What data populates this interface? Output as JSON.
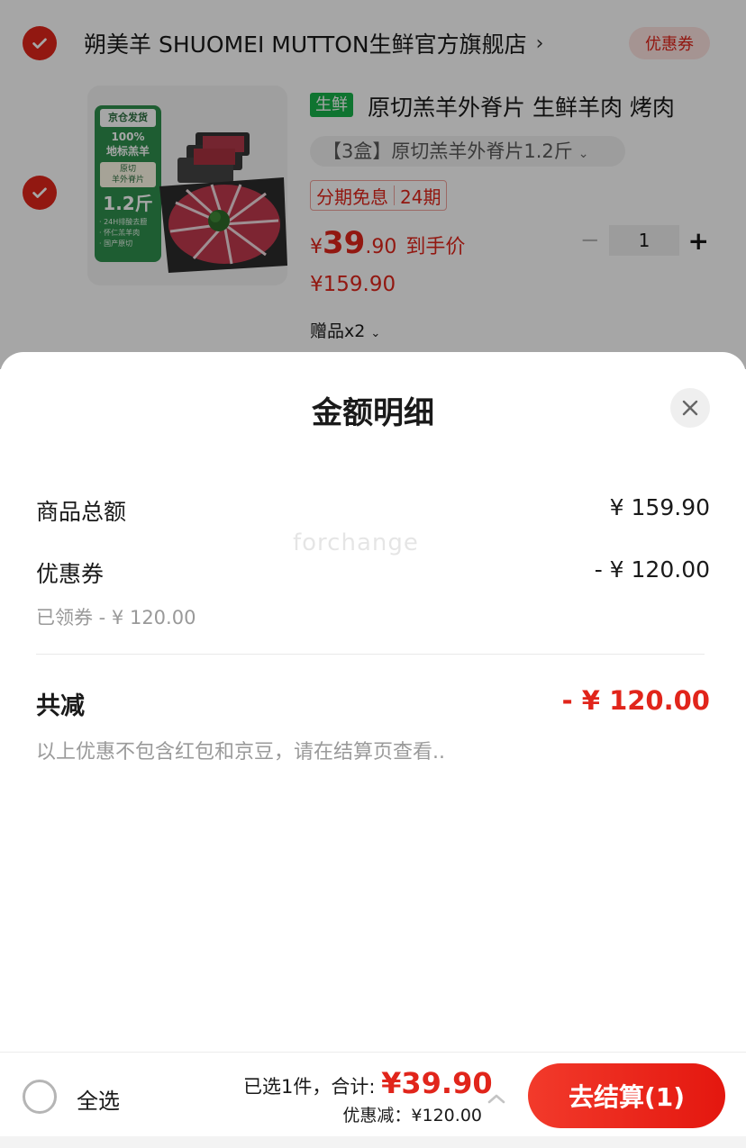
{
  "cart": {
    "store_name": "朔美羊 SHUOMEI MUTTON生鲜官方旗舰店",
    "store_chevron": "›",
    "coupon_button": "优惠券",
    "product": {
      "image_text": {
        "top_badge": "京仓发货",
        "percent": "100%",
        "landmark": "地标羔羊",
        "cut_line1": "原切",
        "cut_line2": "羊外脊片",
        "weight": "1.2斤",
        "bullets": [
          "· 24H排酸去膻",
          "· 怀仁羔羊肉",
          "· 国产原切"
        ]
      },
      "fresh_tag": "生鲜",
      "title": "原切羔羊外脊片 生鲜羊肉 烤肉",
      "spec": "【3盒】原切羔羊外脊片1.2斤",
      "installment_label": "分期免息",
      "installment_period": "24期",
      "price_yen": "¥",
      "price_int": "39",
      "price_dec": ".90",
      "price_label": "到手价",
      "original_price": "¥159.90",
      "gift": "赠品x2",
      "quantity": "1",
      "qty_minus": "−",
      "qty_plus": "+"
    }
  },
  "sheet": {
    "title": "金额明细",
    "watermark": "forchange",
    "rows": {
      "goods_total_label": "商品总额",
      "goods_total_value": "¥ 159.90",
      "coupon_label": "优惠券",
      "coupon_value": "- ¥ 120.00",
      "coupon_sub": "已领券 - ¥ 120.00"
    },
    "total_label": "共减",
    "total_value": "- ¥ 120.00",
    "note": "以上优惠不包含红包和京豆，请在结算页查看.."
  },
  "bottom_bar": {
    "select_all": "全选",
    "selected_label": "已选1件，合计: ",
    "total_amount": "¥39.90",
    "discount_line": "优惠减：¥120.00",
    "checkout": "去结算(1)"
  },
  "colors": {
    "brand_red": "#e1251b",
    "fresh_green": "#17b34a"
  },
  "icons": [
    "check-icon",
    "chevron-right-icon",
    "chevron-down-icon",
    "close-icon",
    "chevron-up-icon"
  ]
}
